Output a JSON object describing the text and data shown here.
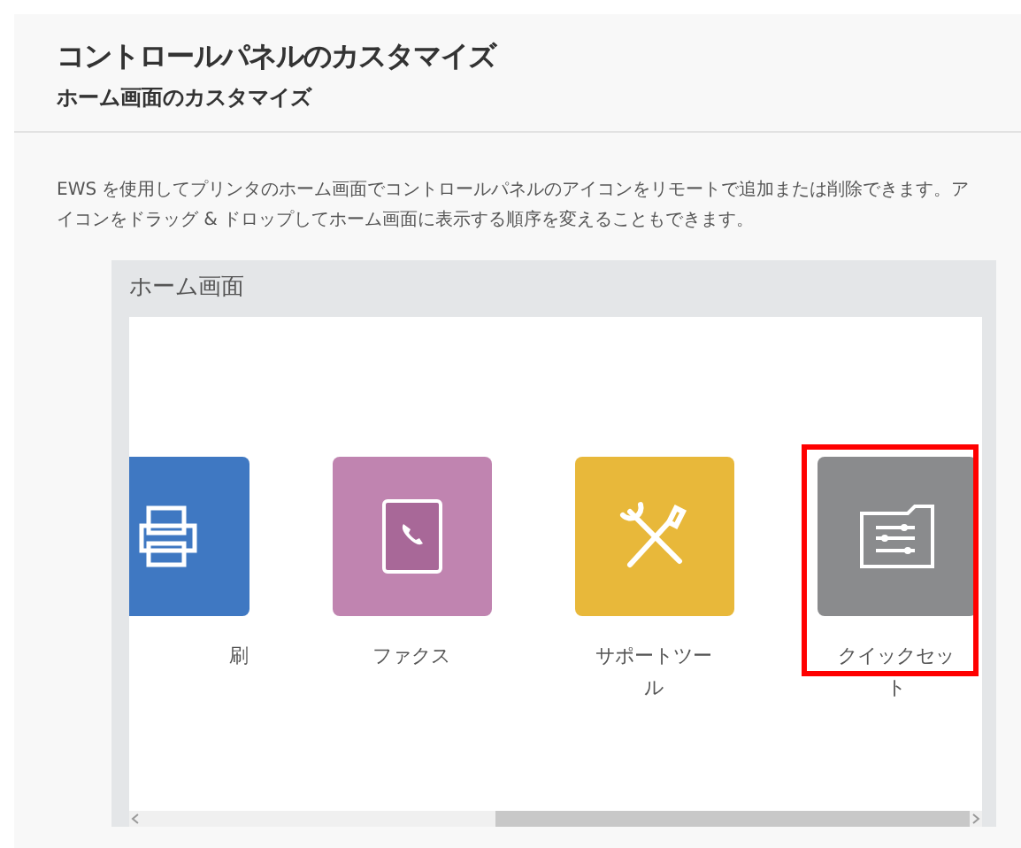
{
  "header": {
    "title": "コントロールパネルのカスタマイズ",
    "subtitle": "ホーム画面のカスタマイズ"
  },
  "description": "EWS を使用してプリンタのホーム画面でコントロールパネルのアイコンをリモートで追加または削除できます。アイコンをドラッグ & ドロップしてホーム画面に表示する順序を変えることもできます。",
  "panel": {
    "title": "ホーム画面",
    "tiles": [
      {
        "kind": "printer",
        "label": "刷",
        "color": "#3f78c2",
        "cut_off": true,
        "highlighted": false
      },
      {
        "kind": "fax",
        "label": "ファクス",
        "color": "#c084b0",
        "cut_off": false,
        "highlighted": false
      },
      {
        "kind": "tools",
        "label": "サポートツール",
        "color": "#e8b83a",
        "cut_off": false,
        "highlighted": false
      },
      {
        "kind": "quickset",
        "label": "クイックセット",
        "color": "#8a8b8d",
        "cut_off": false,
        "highlighted": true
      }
    ]
  }
}
